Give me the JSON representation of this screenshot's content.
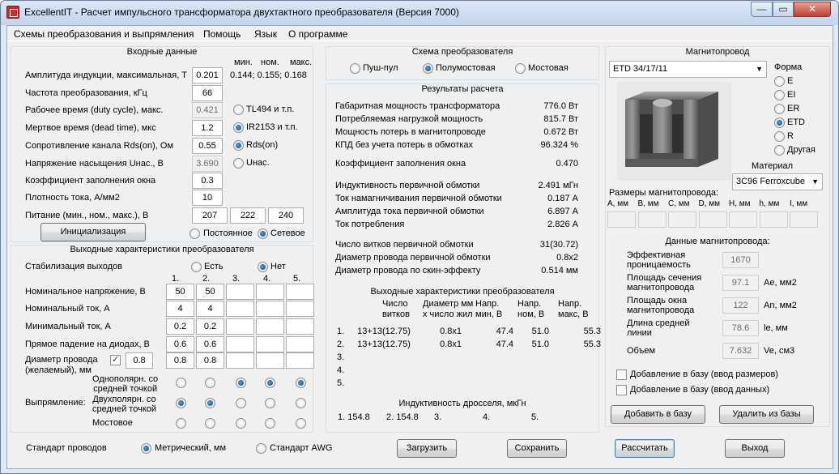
{
  "window": {
    "title": "ExcellentIT - Расчет импульсного трансформатора двухтактного преобразователя (Версия 7000)",
    "min": "—",
    "max": "▭",
    "close": "✕"
  },
  "menu": [
    "Схемы преобразования и выпрямления",
    "Помощь",
    "Язык",
    "О программе"
  ],
  "input": {
    "title": "Входные данные",
    "mnm": [
      "мин.",
      "ном.",
      "макс."
    ],
    "rows": [
      {
        "label": "Амплитуда индукции, максимальная, Т",
        "value": "0.201",
        "extra": "0.144; 0.155; 0.168"
      },
      {
        "label": "Частота преобразования, кГц",
        "value": "66"
      },
      {
        "label": "Рабочее время (duty cycle), макс.",
        "value": "0.421",
        "extra": "TL494 и т.п."
      },
      {
        "label": "Мертвое время (dead time), мкс",
        "value": "1.2",
        "extra": "IR2153 и т.п."
      },
      {
        "label": "Сопротивление канала Rds(on), Ом",
        "value": "0.55",
        "extra": "Rds(on)"
      },
      {
        "label": "Напряжение насыщения Uнас., В",
        "value": "3.690",
        "extra": "Uнас."
      },
      {
        "label": "Коэффициент заполнения окна",
        "value": "0.3"
      },
      {
        "label": "Плотность тока, А/мм2",
        "value": "10"
      },
      {
        "label": "Питание (мин., ном., макс.), В",
        "values": [
          "207",
          "222",
          "240"
        ]
      }
    ],
    "init_button": "Инициализация",
    "supply": [
      "Постоянное",
      "Сетевое"
    ]
  },
  "output": {
    "title": "Выходные характеристики преобразователя",
    "stab_label": "Стабилизация выходов",
    "stab": [
      "Есть",
      "Нет"
    ],
    "cols": [
      "1.",
      "2.",
      "3.",
      "4.",
      "5."
    ],
    "rows": [
      {
        "label": "Номинальное напряжение, В",
        "values": [
          "50",
          "50",
          "",
          "",
          ""
        ]
      },
      {
        "label": "Номинальный ток, А",
        "values": [
          "4",
          "4",
          "",
          "",
          ""
        ]
      },
      {
        "label": "Минимальный ток, А",
        "values": [
          "0.2",
          "0.2",
          "",
          "",
          ""
        ]
      },
      {
        "label": "Прямое падение на диодах, В",
        "values": [
          "0.6",
          "0.6",
          "",
          "",
          ""
        ]
      }
    ],
    "wire_label_1": "Диаметр провода",
    "wire_label_2": "(желаемый), мм",
    "wire_main": "0.8",
    "wire_values": [
      "0.8",
      "0.8",
      "",
      "",
      ""
    ],
    "rect_label": "Выпрямление:",
    "rect_options": [
      {
        "l1": "Однополярн. со",
        "l2": "средней точкой"
      },
      {
        "l1": "Двухполярн. со",
        "l2": "средней точкой"
      },
      {
        "l1": "Мостовое"
      }
    ],
    "rect_sel": [
      1,
      1,
      0,
      0,
      0
    ]
  },
  "wires": {
    "label": "Стандарт проводов",
    "options": [
      "Метрический, мм",
      "Стандарт AWG"
    ]
  },
  "scheme": {
    "title": "Схема преобразователя",
    "options": [
      "Пуш-пул",
      "Полумостовая",
      "Мостовая"
    ]
  },
  "results": {
    "title": "Результаты расчета",
    "groups": [
      [
        [
          "Габаритная мощность трансформатора",
          "776.0 Вт"
        ],
        [
          "Потребляемая нагрузкой мощность",
          "815.7 Вт"
        ],
        [
          "Мощность потерь в магнитопроводе",
          "0.672 Вт"
        ],
        [
          "КПД без учета потерь в обмотках",
          "96.324 %"
        ]
      ],
      [
        [
          "Коэффициент заполнения окна",
          "0.470"
        ]
      ],
      [
        [
          "Индуктивность первичной обмотки",
          "2.491 мГн"
        ],
        [
          "Ток намагничивания первичной обмотки",
          "0.187 А"
        ],
        [
          "Амплитуда тока первичной обмотки",
          "6.897 А"
        ],
        [
          "Ток потребления",
          "2.826 А"
        ]
      ],
      [
        [
          "Число витков первичной обмотки",
          "31(30.72)"
        ],
        [
          "Диаметр провода первичной обмотки",
          "0.8x2"
        ],
        [
          "Диаметр провода по скин-эффекту",
          "0.514 мм"
        ]
      ]
    ],
    "out_title": "Выходные характеристики преобразователя",
    "out_headers": [
      [
        "Число",
        "витков"
      ],
      [
        "Диаметр мм",
        "x число жил"
      ],
      [
        "Напр.",
        "мин, В"
      ],
      [
        "Напр.",
        "ном, В"
      ],
      [
        "Напр.",
        "макс, В"
      ]
    ],
    "out_rows": [
      [
        "1.",
        "13+13(12.75)",
        "0.8x1",
        "47.4",
        "51.0",
        "55.3"
      ],
      [
        "2.",
        "13+13(12.75)",
        "0.8x1",
        "47.4",
        "51.0",
        "55.3"
      ],
      [
        "3.",
        "",
        "",
        "",
        "",
        ""
      ],
      [
        "4.",
        "",
        "",
        "",
        "",
        ""
      ],
      [
        "5.",
        "",
        "",
        "",
        "",
        ""
      ]
    ],
    "choke_title": "Индуктивность дросселя, мкГн",
    "choke": [
      "1. 154.8",
      "2. 154.8",
      "3.",
      "4.",
      "5."
    ]
  },
  "core": {
    "title": "Магнитопровод",
    "selected": "ETD 34/17/11",
    "shape_title": "Форма",
    "shapes": [
      "E",
      "EI",
      "ER",
      "ETD",
      "R",
      "Другая"
    ],
    "shape_selected": "ETD",
    "material_title": "Материал",
    "material": "3C96 Ferroxcube",
    "dims_title": "Размеры магнитопровода:",
    "dims": [
      "A, мм",
      "B, мм",
      "C, мм",
      "D, мм",
      "H, мм",
      "h, мм",
      "I, мм"
    ],
    "data_title": "Данные магнитопровода:",
    "data": [
      {
        "l1": "Эффективная",
        "l2": "проницаемость",
        "value": "1670",
        "unit": ""
      },
      {
        "l1": "Площадь сечения",
        "l2": "магнитопровода",
        "value": "97.1",
        "unit": "Ae, мм2"
      },
      {
        "l1": "Площадь окна",
        "l2": "магнитопровода",
        "value": "122",
        "unit": "An, мм2"
      },
      {
        "l1": "Длина средней",
        "l2": "линии",
        "value": "78.6",
        "unit": "le, мм"
      },
      {
        "l1": "Объем",
        "l2": "",
        "value": "7.632",
        "unit": "Ve, см3"
      }
    ],
    "check1": "Добавление в базу (ввод размеров)",
    "check2": "Добавление в базу (ввод данных)",
    "add_btn": "Добавить в базу",
    "del_btn": "Удалить из базы"
  },
  "buttons": {
    "load": "Загрузить",
    "save": "Сохранить",
    "calc": "Рассчитать",
    "exit": "Выход"
  }
}
